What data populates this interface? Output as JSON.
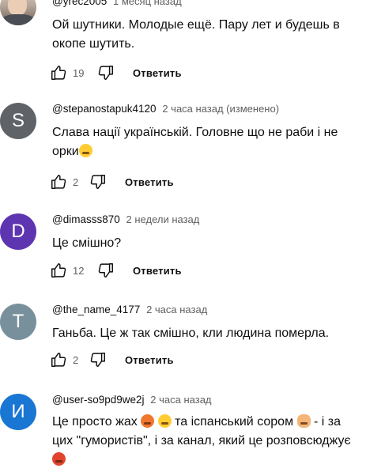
{
  "comments": [
    {
      "author": "@yrec2005",
      "time": "1 месяц назад",
      "text": "Ой шутники. Молодые ещё. Пару лет и будешь в окопе шутить.",
      "likes": "19",
      "reply_label": "Ответить",
      "avatar": {
        "type": "photo"
      }
    },
    {
      "author": "@stepanostapuk4120",
      "time": "2 часа назад (изменено)",
      "text": "Слава нації українській. Головне що не раби і не орки",
      "likes": "2",
      "reply_label": "Ответить",
      "avatar": {
        "type": "letter",
        "letter": "S",
        "color": "#5f6368"
      },
      "emoji_after": "laugh-emoji"
    },
    {
      "author": "@dimasss870",
      "time": "2 недели назад",
      "text": "Це смішно?",
      "likes": "12",
      "reply_label": "Ответить",
      "avatar": {
        "type": "letter",
        "letter": "D",
        "color": "#5e35b1"
      }
    },
    {
      "author": "@the_name_4177",
      "time": "2 часа назад",
      "text": "Ганьба. Це ж так смішно, кли людина померла.",
      "likes": "2",
      "reply_label": "Ответить",
      "avatar": {
        "type": "letter",
        "letter": "T",
        "color": "#78909c"
      }
    },
    {
      "author": "@user-so9pd9we2j",
      "time": "2 часа назад",
      "text_parts": [
        "Це просто жах",
        " та іспанський сором ",
        " - і за цих \"гумористів\", і за канал, який це розповсюджує"
      ],
      "avatar": {
        "type": "letter",
        "letter": "И",
        "color": "#1976d2"
      }
    }
  ],
  "icons": {
    "like": "thumbs-up-icon",
    "dislike": "thumbs-down-icon"
  }
}
